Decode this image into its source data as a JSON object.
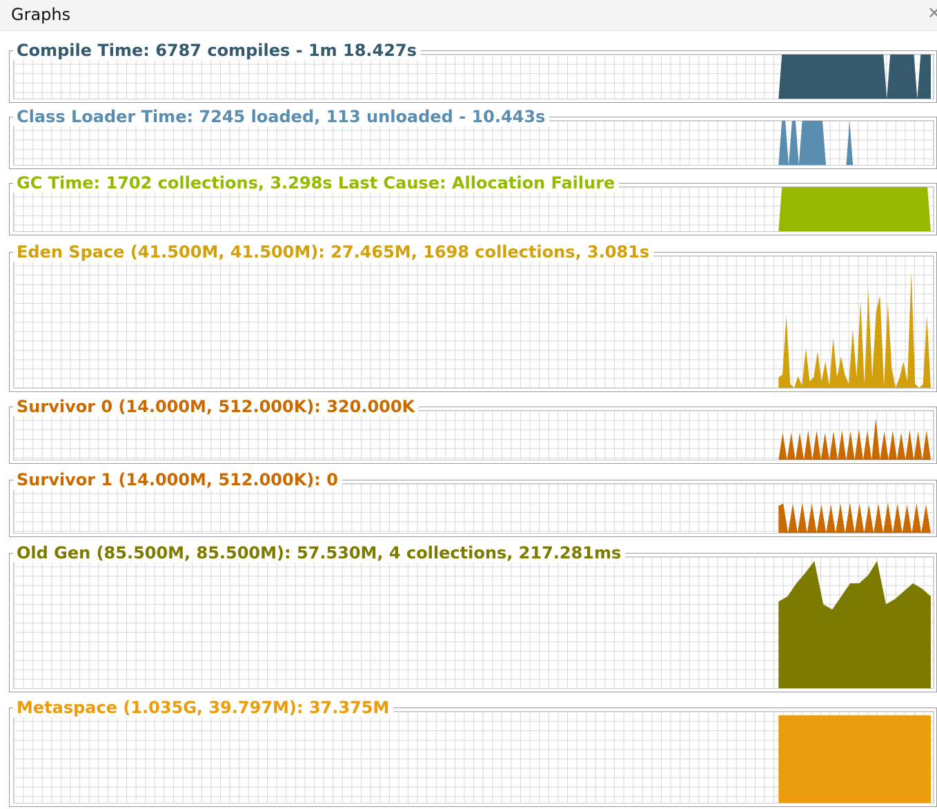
{
  "window": {
    "title": "Graphs",
    "close_icon": "close-icon"
  },
  "graphs": [
    {
      "title": "Compile Time: 6787 compiles - 1m 18.427s",
      "color": "#355a6e",
      "chart_data": {
        "type": "area",
        "series_level_pct": [
          0,
          100,
          100,
          100,
          100,
          100,
          100,
          100,
          100,
          100,
          100,
          100,
          100,
          100,
          100,
          100,
          100,
          100,
          100,
          100,
          100,
          100,
          100,
          100,
          100,
          100,
          100,
          100,
          100,
          100,
          100,
          100,
          0,
          100,
          100,
          100,
          100,
          100,
          100,
          100,
          100,
          0,
          100,
          100,
          100,
          100
        ]
      }
    },
    {
      "title": "Class Loader Time: 7245 loaded, 113 unloaded - 10.443s",
      "color": "#5b8db0",
      "chart_data": {
        "type": "area",
        "series_level_pct": [
          0,
          100,
          100,
          0,
          100,
          100,
          0,
          100,
          100,
          100,
          100,
          100,
          100,
          100,
          0,
          0,
          0,
          0,
          0,
          0,
          0,
          100,
          0,
          0,
          0,
          0,
          0,
          0,
          0,
          0,
          0,
          0,
          0,
          0,
          0,
          0,
          0,
          0,
          0,
          0,
          0,
          0,
          0,
          0,
          0,
          0
        ]
      }
    },
    {
      "title": "GC Time: 1702 collections, 3.298s  Last Cause: Allocation Failure",
      "color": "#97b800",
      "chart_data": {
        "type": "area",
        "series_level_pct": [
          0,
          100,
          100,
          100,
          100,
          100,
          100,
          100,
          100,
          100,
          100,
          100,
          100,
          100,
          100,
          100,
          100,
          100,
          100,
          100,
          100,
          100,
          100,
          100,
          100,
          100,
          100,
          100,
          100,
          100,
          100,
          100,
          100,
          100,
          100,
          100,
          100,
          100,
          100,
          100,
          100,
          100,
          100,
          100,
          100,
          0
        ]
      }
    },
    {
      "title": "Eden Space (41.500M, 41.500M): 27.465M, 1698 collections, 3.081s",
      "color": "#d3a00d",
      "chart_data": {
        "type": "area",
        "series_level_pct": [
          8,
          10,
          55,
          3,
          0,
          9,
          2,
          30,
          5,
          8,
          28,
          5,
          20,
          2,
          38,
          8,
          24,
          10,
          3,
          45,
          8,
          66,
          3,
          74,
          8,
          58,
          70,
          2,
          65,
          15,
          0,
          8,
          20,
          5,
          88,
          3,
          0,
          3,
          55,
          0
        ]
      }
    },
    {
      "title": "Survivor 0 (14.000M, 512.000K): 320.000K",
      "color": "#c96a00",
      "chart_data": {
        "type": "area",
        "series_level_pct": [
          0,
          55,
          0,
          55,
          0,
          55,
          0,
          60,
          0,
          60,
          0,
          55,
          0,
          58,
          0,
          60,
          0,
          58,
          0,
          62,
          0,
          60,
          0,
          85,
          0,
          58,
          0,
          60,
          0,
          55,
          0,
          60,
          0,
          58,
          0,
          60,
          0
        ]
      }
    },
    {
      "title": "Survivor 1 (14.000M, 512.000K): 0",
      "color": "#c96a00",
      "chart_data": {
        "type": "area",
        "series_level_pct": [
          55,
          60,
          0,
          60,
          0,
          62,
          0,
          60,
          0,
          58,
          0,
          58,
          0,
          60,
          0,
          62,
          0,
          60,
          0,
          58,
          0,
          60,
          0,
          62,
          0,
          60,
          0,
          58,
          0,
          60,
          0,
          58,
          0
        ]
      }
    },
    {
      "title": "Old Gen (85.500M, 85.500M): 57.530M, 4 collections, 217.281ms",
      "color": "#7d7a00",
      "chart_data": {
        "type": "area",
        "series_level_pct": [
          66,
          70,
          80,
          88,
          97,
          64,
          60,
          70,
          80,
          80,
          86,
          97,
          64,
          68,
          74,
          80,
          76,
          70
        ]
      }
    },
    {
      "title": "Metaspace (1.035G, 39.797M): 37.375M",
      "color": "#eb9c0c",
      "chart_data": {
        "type": "area",
        "series_level_pct": [
          96,
          96,
          96,
          96,
          96,
          96,
          96,
          96,
          96,
          96,
          96,
          96,
          96,
          96,
          96,
          96,
          96,
          96,
          96,
          96
        ]
      }
    }
  ]
}
